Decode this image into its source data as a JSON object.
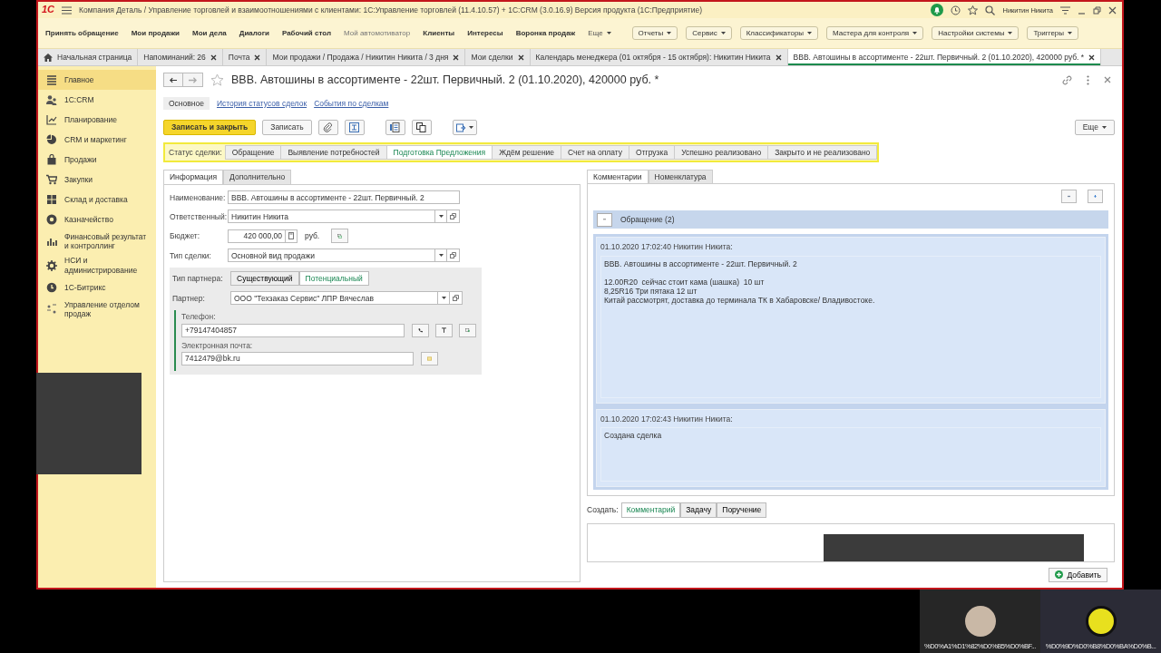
{
  "window": {
    "logo": "1С",
    "title": "Компания Деталь / Управление торговлей и взаимоотношениями с клиентами: 1С:Управление торговлей (11.4.10.57) + 1С:CRM (3.0.16.9) Версия продукта  (1С:Предприятие)",
    "user": "Никитин Никита",
    "notification": true
  },
  "menu": [
    {
      "label": "Принять обращение",
      "kind": "link"
    },
    {
      "label": "Мои продажи",
      "kind": "link"
    },
    {
      "label": "Мои дела",
      "kind": "link"
    },
    {
      "label": "Диалоги",
      "kind": "link"
    },
    {
      "label": "Рабочий стол",
      "kind": "link"
    },
    {
      "label": "Мой автомотиватор",
      "kind": "muted"
    },
    {
      "label": "Клиенты",
      "kind": "link"
    },
    {
      "label": "Интересы",
      "kind": "link"
    },
    {
      "label": "Воронка продаж",
      "kind": "link"
    },
    {
      "label": "Еще",
      "kind": "more"
    },
    {
      "label": "Отчеты",
      "kind": "button"
    },
    {
      "label": "Сервис",
      "kind": "button"
    },
    {
      "label": "Классификаторы",
      "kind": "button"
    },
    {
      "label": "Мастера для контроля",
      "kind": "button"
    },
    {
      "label": "Настройки системы",
      "kind": "button"
    },
    {
      "label": "Триггеры",
      "kind": "button"
    }
  ],
  "open_tabs": [
    {
      "label": "Начальная страница",
      "kind": "home",
      "selected": false
    },
    {
      "label": "Напоминаний: 26",
      "kind": "doc",
      "selected": false
    },
    {
      "label": "Почта",
      "kind": "doc",
      "selected": false
    },
    {
      "label": "Мои продажи / Продажа / Никитин Никита / 3 дня",
      "kind": "doc",
      "selected": false
    },
    {
      "label": "Мои сделки",
      "kind": "doc",
      "selected": false
    },
    {
      "label": "Календарь менеджера (01 октября - 15 октября): Никитин Никита",
      "kind": "doc",
      "selected": false
    },
    {
      "label": "ВВВ. Автошины в ассортименте - 22шт. Первичный. 2 (01.10.2020), 420000 руб. *",
      "kind": "doc",
      "selected": true
    }
  ],
  "sidebar": [
    {
      "label": "Главное",
      "selected": true
    },
    {
      "label": "1С:CRM",
      "selected": false
    },
    {
      "label": "Планирование",
      "selected": false
    },
    {
      "label": "CRM и маркетинг",
      "selected": false
    },
    {
      "label": "Продажи",
      "selected": false
    },
    {
      "label": "Закупки",
      "selected": false
    },
    {
      "label": "Склад и доставка",
      "selected": false
    },
    {
      "label": "Казначейство",
      "selected": false
    },
    {
      "label": "Финансовый результат и контроллинг",
      "selected": false
    },
    {
      "label": "НСИ и администрирование",
      "selected": false
    },
    {
      "label": "1С-Битрикс",
      "selected": false
    },
    {
      "label": "Управление отделом продаж",
      "selected": false
    }
  ],
  "form": {
    "title": "ВВВ. Автошины в ассортименте - 22шт. Первичный. 2 (01.10.2020), 420000 руб. *",
    "sections": [
      {
        "label": "Основное",
        "selected": true
      },
      {
        "label": "История статусов сделок",
        "selected": false
      },
      {
        "label": "События по сделкам",
        "selected": false
      }
    ],
    "save_close": "Записать и закрыть",
    "save": "Записать",
    "more": "Еще",
    "status_label": "Статус сделки:",
    "stages": [
      {
        "label": "Обращение",
        "selected": false
      },
      {
        "label": "Выявление потребностей",
        "selected": false
      },
      {
        "label": "Подготовка Предложения",
        "selected": true
      },
      {
        "label": "Ждём решение",
        "selected": false
      },
      {
        "label": "Счет на оплату",
        "selected": false
      },
      {
        "label": "Отгрузка",
        "selected": false
      },
      {
        "label": "Успешно реализовано",
        "selected": false
      },
      {
        "label": "Закрыто и не реализовано",
        "selected": false
      }
    ]
  },
  "info": {
    "tabs": [
      {
        "label": "Информация",
        "selected": true
      },
      {
        "label": "Дополнительно",
        "selected": false
      }
    ],
    "fields": [
      {
        "kind": "text",
        "label": "Наименование:",
        "value": "ВВВ. Автошины в ассортименте - 22шт. Первичный. 2"
      },
      {
        "kind": "select",
        "label": "Ответственный:",
        "value": "Никитин Никита"
      },
      {
        "kind": "money",
        "label": "Бюджет:",
        "value": "420 000,00",
        "unit": "руб."
      },
      {
        "kind": "select",
        "label": "Тип сделки:",
        "value": "Основной вид продажи"
      }
    ],
    "partner_type_label": "Тип партнера:",
    "partner_types": [
      {
        "label": "Существующий",
        "selected": false
      },
      {
        "label": "Потенциальный",
        "selected": true
      }
    ],
    "partner": {
      "label": "Партнер:",
      "value": "ООО \"Техзаказ Сервис\"  ЛПР Вячеслав"
    },
    "contacts": [
      {
        "kind": "phone",
        "label": "Телефон:",
        "value": "+79147404857"
      },
      {
        "kind": "email",
        "label": "Электронная почта:",
        "value": "7412479@bk.ru"
      }
    ]
  },
  "comments": {
    "tabs": [
      {
        "label": "Комментарии",
        "selected": true
      },
      {
        "label": "Номенклатура",
        "selected": false
      }
    ],
    "group": {
      "title": "Обращение (2)",
      "expanded": true
    },
    "entries": [
      {
        "header": "01.10.2020 17:02:40 Никитин Никита:",
        "text": "ВВВ. Автошины в ассортименте - 22шт. Первичный. 2\n\n12.00R20  сейчас стоит кама (шашка)  10 шт\n8,25R16 Три пятака 12 шт\nКитай рассмотрят, доставка до терминала ТК в Хабаровске/ Владивостоке."
      },
      {
        "header": "01.10.2020 17:02:43 Никитин Никита:",
        "text": "Создана сделка"
      }
    ],
    "create_label": "Создать:",
    "create_options": [
      {
        "label": "Комментарий",
        "selected": true
      },
      {
        "label": "Задачу",
        "selected": false
      },
      {
        "label": "Поручение",
        "selected": false
      }
    ],
    "add_button": "Добавить"
  },
  "participants": [
    {
      "name": "%D0%A1%D1%82%D0%B5%D0%BF...",
      "kind": "photo"
    },
    {
      "name": "%D0%9D%D0%B8%D0%BA%D0%B...",
      "kind": "emblem"
    }
  ]
}
